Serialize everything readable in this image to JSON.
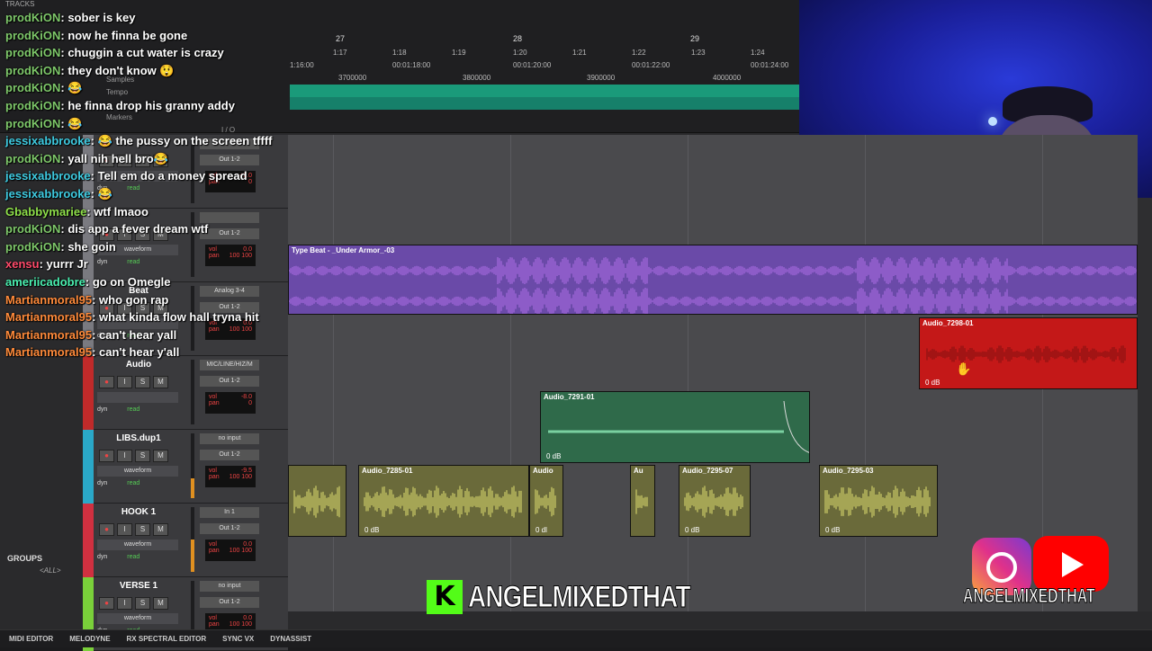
{
  "ruler": {
    "header": "TRACKS",
    "bars": [
      "27",
      "28",
      "29"
    ],
    "beats": [
      "1:17",
      "1:18",
      "1:19",
      "1:20",
      "1:21",
      "1:22",
      "1:23",
      "1:24"
    ],
    "timecode": [
      "1:16:00",
      "00:01:18:00",
      "00:01:20:00",
      "00:01:22:00",
      "00:01:24:00"
    ],
    "samples": [
      "3700000",
      "3800000",
      "3900000",
      "4000000"
    ],
    "lane_labels": {
      "samples": "Samples",
      "tempo": "Tempo",
      "markers": "Markers",
      "io": "I / O"
    }
  },
  "tracks": [
    {
      "name": "",
      "input": "",
      "output": "Out 1-2",
      "view": "",
      "vol": "+2.0",
      "pan": "0",
      "color": "#7a7a80",
      "meter": 0
    },
    {
      "name": "",
      "input": "",
      "output": "Out 1-2",
      "view": "waveform",
      "vol": "0.0",
      "pan": "100  100",
      "color": "#7a7a80",
      "meter": 0
    },
    {
      "name": "Beat",
      "input": "Analog 3-4",
      "output": "Out 1-2",
      "view": "",
      "vol": "0.0",
      "pan": "100  100",
      "color": "#7a7a80",
      "meter": 0
    },
    {
      "name": "Audio",
      "input": "MIC/LINE/HIZ/M",
      "output": "Out 1-2",
      "view": "",
      "vol": "-8.0",
      "pan": "0",
      "color": "#c02a2a",
      "meter": 0
    },
    {
      "name": "LIBS.dup1",
      "input": "no input",
      "output": "Out 1-2",
      "view": "waveform",
      "vol": "-9.5",
      "pan": "100  100",
      "color": "#2aa8c8",
      "meter": 0.3
    },
    {
      "name": "HOOK 1",
      "input": "In 1",
      "output": "Out 1-2",
      "view": "waveform",
      "vol": "0.0",
      "pan": "100  100",
      "color": "#d03040",
      "meter": 0.5
    },
    {
      "name": "VERSE 1",
      "input": "no input",
      "output": "Out 1-2",
      "view": "waveform",
      "vol": "0.0",
      "pan": "100  100",
      "color": "#7ad03a",
      "meter": 0
    }
  ],
  "track_buttons": {
    "rec": "●",
    "input": "I",
    "solo": "S",
    "mute": "M",
    "dyn": "dyn",
    "read": "read",
    "vol_label": "vol",
    "pan_label": "pan"
  },
  "clips": {
    "beat": "Type Beat - _Under Armor_-03",
    "audio_red": "Audio_7298-01",
    "audio_red_db": "0 dB",
    "libs": "Audio_7291-01",
    "libs_db": "0 dB",
    "hook": [
      {
        "name": "",
        "db": ""
      },
      {
        "name": "Audio_7285-01",
        "db": "0 dB"
      },
      {
        "name": "Audio",
        "db": "0 dl"
      },
      {
        "name": "Au",
        "db": ""
      },
      {
        "name": "Audio_7295-07",
        "db": "0 dB"
      },
      {
        "name": "Audio_7295-03",
        "db": "0 dB"
      }
    ]
  },
  "sidebar": {
    "groups": "GROUPS",
    "all": "<ALL>"
  },
  "bottombar": [
    "MIDI EDITOR",
    "MELODYNE",
    "RX SPECTRAL EDITOR",
    "SYNC VX",
    "DYNASSIST"
  ],
  "chat": [
    {
      "user": "prodKiON",
      "msg": ": sober is key",
      "color": "#7ec86a"
    },
    {
      "user": "prodKiON",
      "msg": ": now he finna be gone",
      "color": "#7ec86a"
    },
    {
      "user": "prodKiON",
      "msg": ": chuggin a cut water is crazy",
      "color": "#7ec86a"
    },
    {
      "user": "prodKiON",
      "msg": ": they don't know 😲",
      "color": "#7ec86a"
    },
    {
      "user": "prodKiON",
      "msg": ": 😂",
      "color": "#7ec86a"
    },
    {
      "user": "prodKiON",
      "msg": ": he finna drop his granny addy",
      "color": "#7ec86a"
    },
    {
      "user": "prodKiON",
      "msg": ": 😂",
      "color": "#7ec86a"
    },
    {
      "user": "jessixabbrooke",
      "msg": ": 😂 the pussy on the screen tffff",
      "color": "#3ecae0"
    },
    {
      "user": "prodKiON",
      "msg": ": yall nih hell bro😂",
      "color": "#7ec86a"
    },
    {
      "user": "jessixabbrooke",
      "msg": ": Tell em do a money spread",
      "color": "#3ecae0"
    },
    {
      "user": "jessixabbrooke",
      "msg": ": 😂",
      "color": "#3ecae0"
    },
    {
      "user": "Gbabbymariee",
      "msg": ": wtf lmaoo",
      "color": "#8fe04a"
    },
    {
      "user": "prodKiON",
      "msg": ": dis app a fever dream wtf",
      "color": "#7ec86a"
    },
    {
      "user": "prodKiON",
      "msg": ": she goin",
      "color": "#7ec86a"
    },
    {
      "user": "xensu",
      "msg": ": yurrr Jr",
      "color": "#ff4a6a"
    },
    {
      "user": "ameriicadobre",
      "msg": ": go on Omegle",
      "color": "#4af0b0"
    },
    {
      "user": "Martianmoral95",
      "msg": ": who gon rap",
      "color": "#ff8a3a"
    },
    {
      "user": "Martianmoral95",
      "msg": ": what kinda flow hall tryna hit",
      "color": "#ff8a3a"
    },
    {
      "user": "Martianmoral95",
      "msg": ": can't hear yall",
      "color": "#ff8a3a"
    },
    {
      "user": "Martianmoral95",
      "msg": ": can't hear y'all",
      "color": "#ff8a3a"
    }
  ],
  "watermark": {
    "k": "K",
    "text": "ANGELMIXEDTHAT"
  },
  "socials": {
    "text": "ANGELMIXEDTHAT",
    "icons": [
      "instagram-icon",
      "youtube-icon"
    ]
  }
}
